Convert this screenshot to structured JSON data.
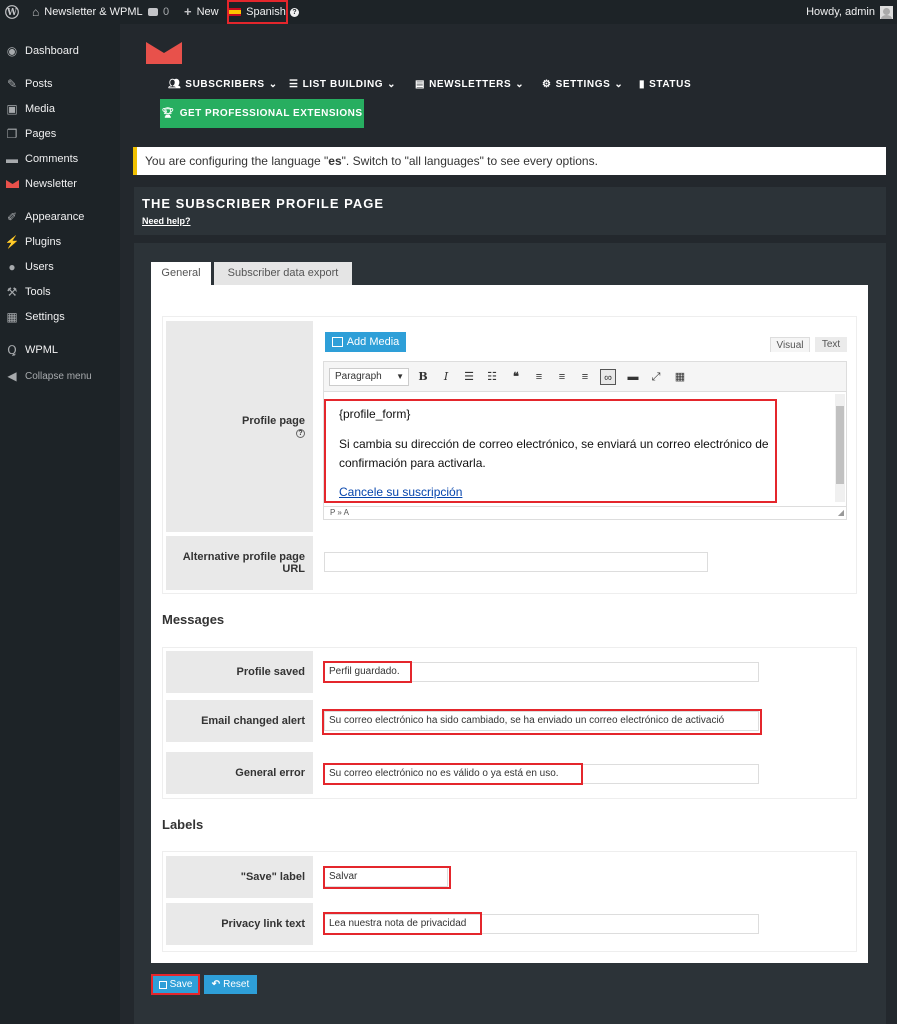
{
  "adminbar": {
    "site_name": "Newsletter & WPML",
    "comments_count": "0",
    "new_label": "New",
    "language": "Spanish",
    "howdy": "Howdy, admin"
  },
  "sidebar": {
    "items": [
      {
        "label": "Dashboard",
        "icon": "dashboard-icon"
      },
      {
        "label": "Posts",
        "icon": "pin-icon"
      },
      {
        "label": "Media",
        "icon": "media-icon"
      },
      {
        "label": "Pages",
        "icon": "pages-icon"
      },
      {
        "label": "Comments",
        "icon": "comments-icon"
      },
      {
        "label": "Newsletter",
        "icon": "newsletter-icon"
      },
      {
        "label": "Appearance",
        "icon": "brush-icon"
      },
      {
        "label": "Plugins",
        "icon": "plugin-icon"
      },
      {
        "label": "Users",
        "icon": "user-icon"
      },
      {
        "label": "Tools",
        "icon": "wrench-icon"
      },
      {
        "label": "Settings",
        "icon": "settings-icon"
      },
      {
        "label": "WPML",
        "icon": "wpml-icon"
      },
      {
        "label": "Collapse menu",
        "icon": "collapse-icon"
      }
    ]
  },
  "nav": {
    "items": [
      "SUBSCRIBERS",
      "LIST BUILDING",
      "NEWSLETTERS",
      "SETTINGS",
      "STATUS"
    ],
    "pro_button": "GET PROFESSIONAL EXTENSIONS"
  },
  "notice": {
    "before": "You are configuring the language \"",
    "lang": "es",
    "after": "\". Switch to \"all languages\" to see every options."
  },
  "page": {
    "title": "THE SUBSCRIBER PROFILE PAGE",
    "help": "Need help?"
  },
  "tabs": [
    "General",
    "Subscriber data export"
  ],
  "profile": {
    "label": "Profile page",
    "add_media": "Add Media",
    "visual": "Visual",
    "text": "Text",
    "format": "Paragraph",
    "line1": "{profile_form}",
    "line2": "Si cambia su dirección de correo electrónico, se enviará un correo electrónico de",
    "line3": "confirmación para activarla.",
    "link": "Cancele su suscripción",
    "path": "P » A"
  },
  "alt_url": {
    "label_1": "Alternative profile page",
    "label_2": "URL",
    "value": ""
  },
  "messages": {
    "heading": "Messages",
    "profile_saved_label": "Profile saved",
    "profile_saved_value": "Perfil guardado.",
    "email_changed_label": "Email changed alert",
    "email_changed_value": "Su correo electrónico ha sido cambiado, se ha enviado un correo electrónico de activació",
    "general_error_label": "General error",
    "general_error_value": "Su correo electrónico no es válido o ya está en uso."
  },
  "labels": {
    "heading": "Labels",
    "save_label_label": "\"Save\" label",
    "save_label_value": "Salvar",
    "privacy_label": "Privacy link text",
    "privacy_value": "Lea nuestra nota de privacidad"
  },
  "buttons": {
    "save": "Save",
    "reset": "Reset"
  },
  "colors": {
    "admin_bar": "#1d2327",
    "background": "#23282d",
    "green": "#27ae60",
    "blue": "#2e9fd8",
    "highlight": "#e4262c",
    "notice_border": "#f0c000"
  }
}
